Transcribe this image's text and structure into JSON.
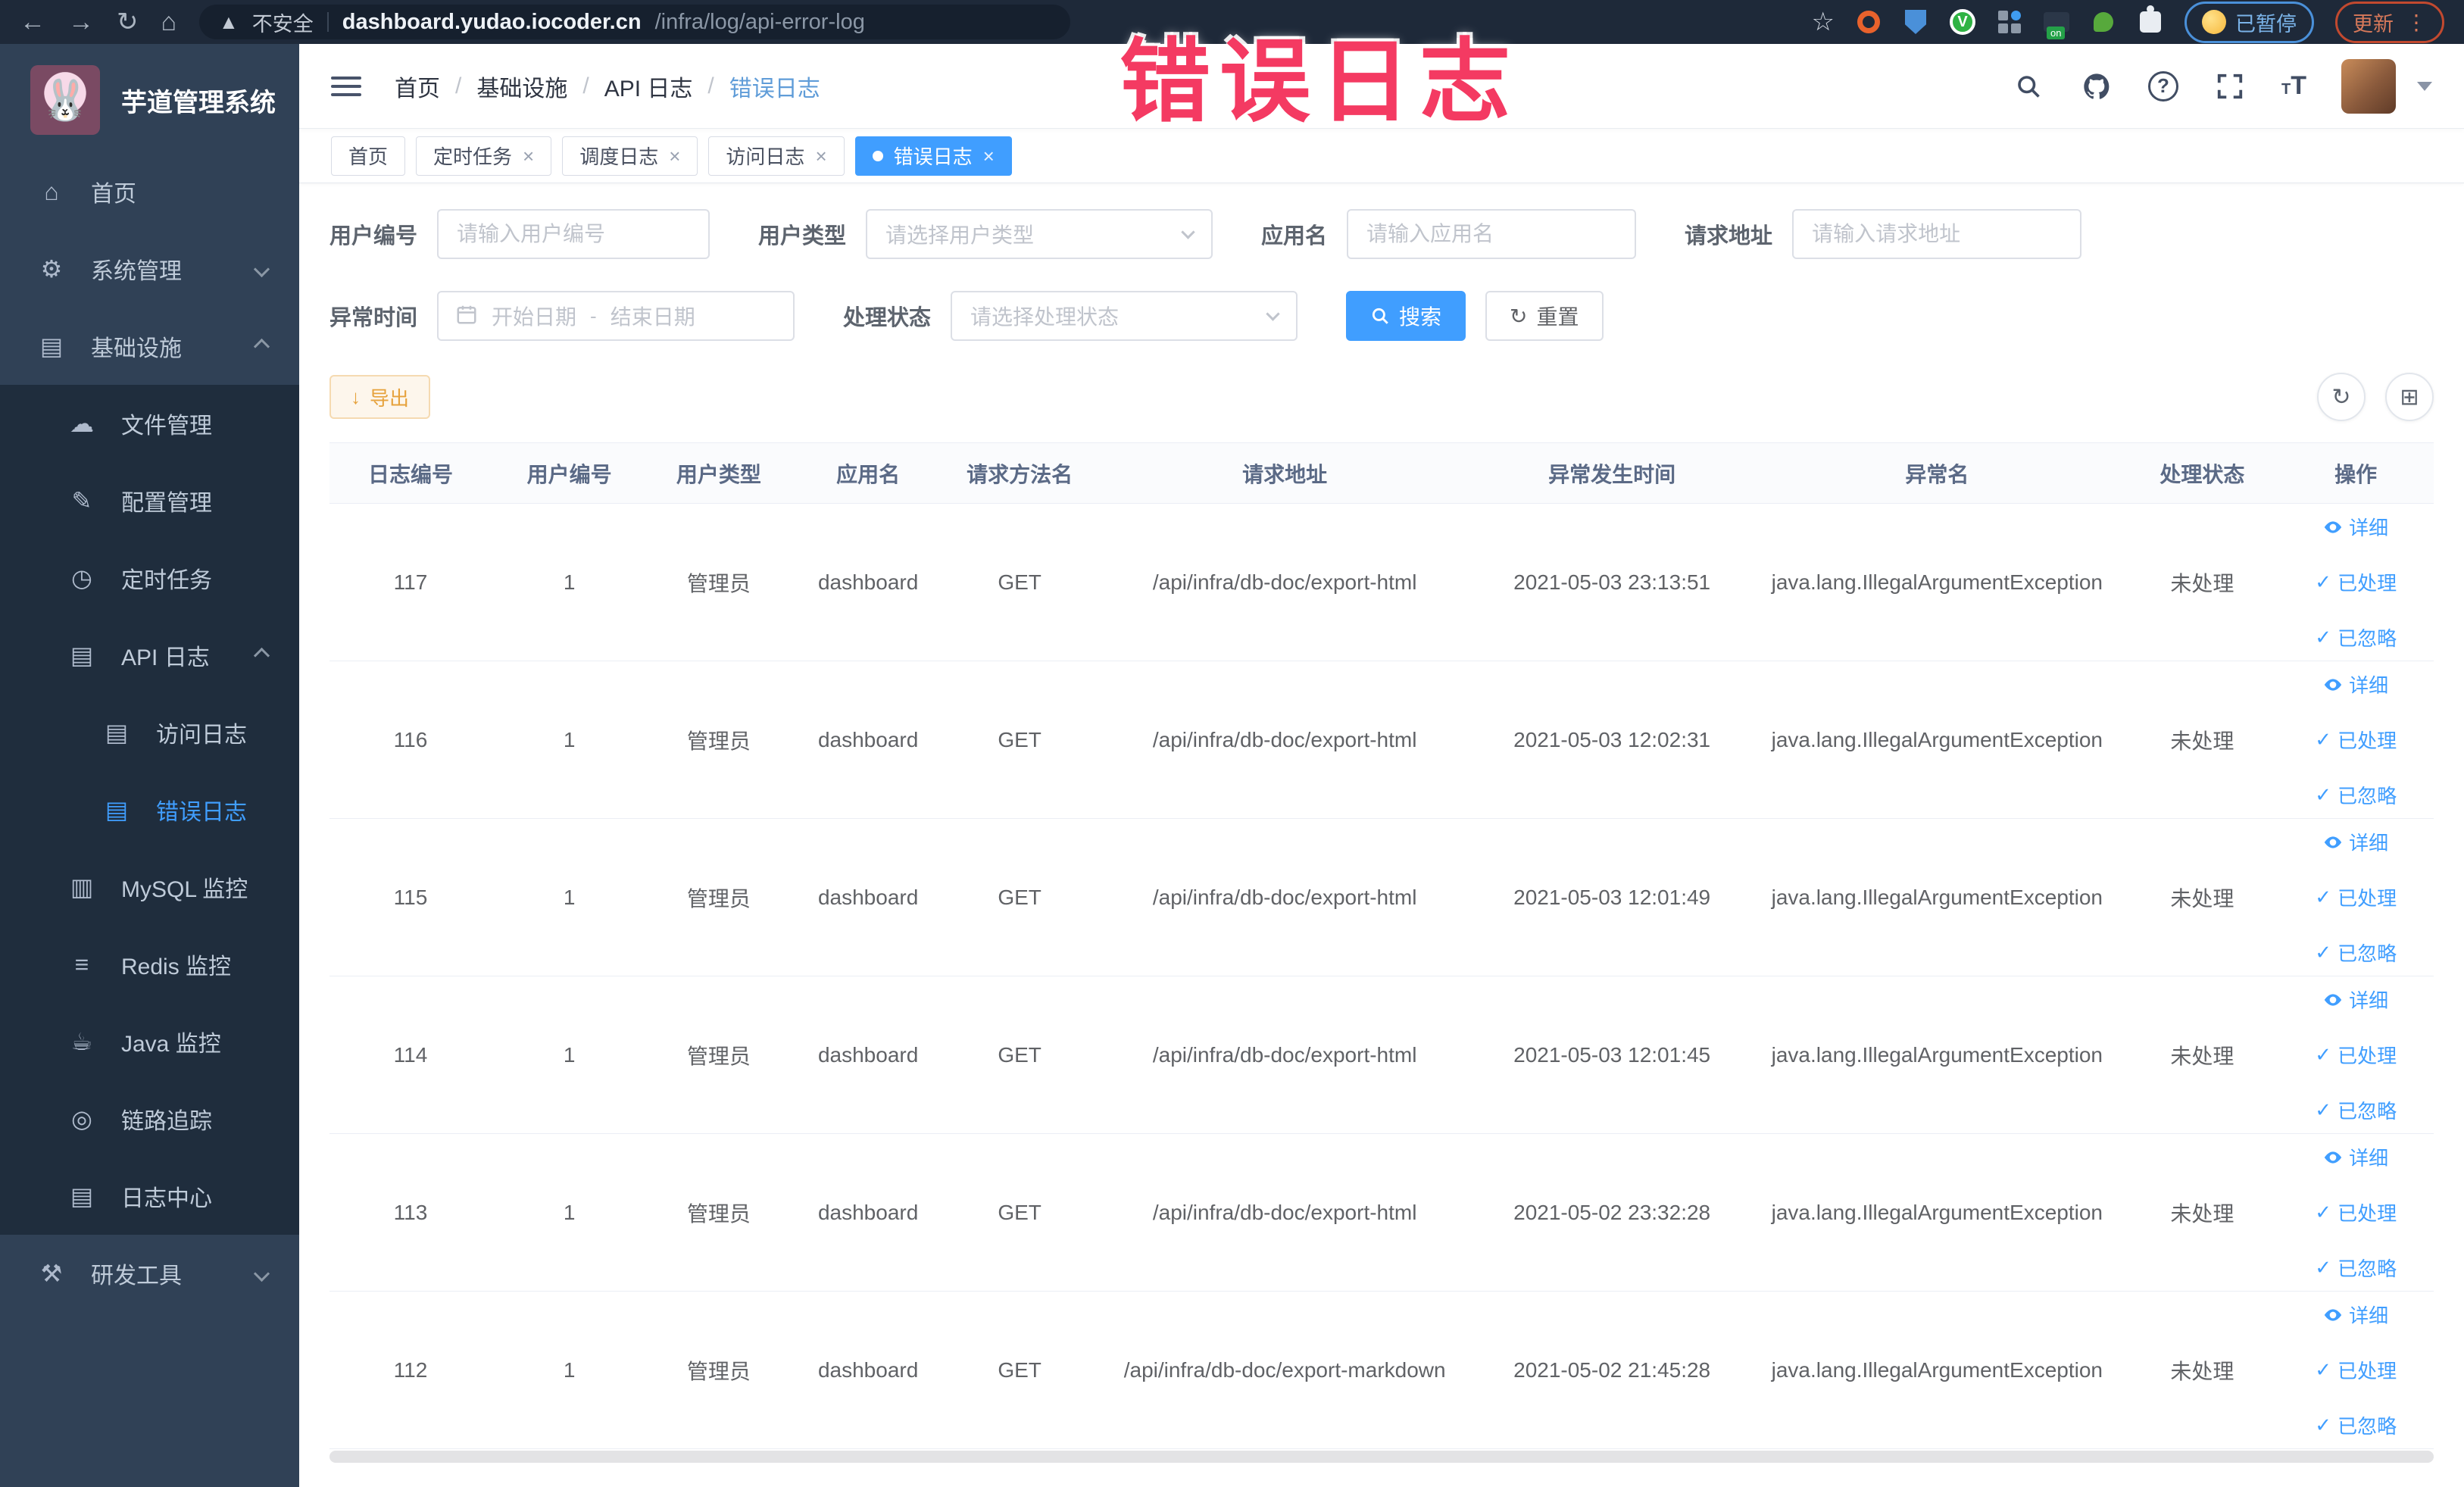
{
  "browser": {
    "security_label": "不安全",
    "url_host": "dashboard.yudao.iocoder.cn",
    "url_path": "/infra/log/api-error-log",
    "paused_label": "已暂停",
    "update_label": "更新"
  },
  "annotation": {
    "text": "错误日志",
    "color": "#f43a62"
  },
  "sidebar": {
    "title": "芋道管理系统",
    "items": [
      {
        "label": "首页"
      },
      {
        "label": "系统管理"
      },
      {
        "label": "基础设施"
      },
      {
        "label": "文件管理"
      },
      {
        "label": "配置管理"
      },
      {
        "label": "定时任务"
      },
      {
        "label": "API 日志"
      },
      {
        "label": "访问日志"
      },
      {
        "label": "错误日志"
      },
      {
        "label": "MySQL 监控"
      },
      {
        "label": "Redis 监控"
      },
      {
        "label": "Java 监控"
      },
      {
        "label": "链路追踪"
      },
      {
        "label": "日志中心"
      },
      {
        "label": "研发工具"
      }
    ]
  },
  "header": {
    "breadcrumb": [
      "首页",
      "基础设施",
      "API 日志",
      "错误日志"
    ]
  },
  "tabs": [
    {
      "label": "首页",
      "closable": false,
      "active": false
    },
    {
      "label": "定时任务",
      "closable": true,
      "active": false
    },
    {
      "label": "调度日志",
      "closable": true,
      "active": false
    },
    {
      "label": "访问日志",
      "closable": true,
      "active": false
    },
    {
      "label": "错误日志",
      "closable": true,
      "active": true
    }
  ],
  "filters": {
    "user_id_label": "用户编号",
    "user_id_placeholder": "请输入用户编号",
    "user_type_label": "用户类型",
    "user_type_placeholder": "请选择用户类型",
    "app_name_label": "应用名",
    "app_name_placeholder": "请输入应用名",
    "request_url_label": "请求地址",
    "request_url_placeholder": "请输入请求地址",
    "exception_time_label": "异常时间",
    "date_start_placeholder": "开始日期",
    "date_separator": "-",
    "date_end_placeholder": "结束日期",
    "process_status_label": "处理状态",
    "process_status_placeholder": "请选择处理状态",
    "search_label": "搜索",
    "reset_label": "重置"
  },
  "toolbar": {
    "export_label": "导出"
  },
  "table": {
    "columns": [
      "日志编号",
      "用户编号",
      "用户类型",
      "应用名",
      "请求方法名",
      "请求地址",
      "异常发生时间",
      "异常名",
      "处理状态",
      "操作"
    ],
    "actions": [
      "详细",
      "已处理",
      "已忽略"
    ],
    "rows": [
      {
        "id": "117",
        "user_id": "1",
        "user_type": "管理员",
        "app": "dashboard",
        "method": "GET",
        "url": "/api/infra/db-doc/export-html",
        "time": "2021-05-03 23:13:51",
        "exception": "java.lang.IllegalArgumentException",
        "status": "未处理"
      },
      {
        "id": "116",
        "user_id": "1",
        "user_type": "管理员",
        "app": "dashboard",
        "method": "GET",
        "url": "/api/infra/db-doc/export-html",
        "time": "2021-05-03 12:02:31",
        "exception": "java.lang.IllegalArgumentException",
        "status": "未处理"
      },
      {
        "id": "115",
        "user_id": "1",
        "user_type": "管理员",
        "app": "dashboard",
        "method": "GET",
        "url": "/api/infra/db-doc/export-html",
        "time": "2021-05-03 12:01:49",
        "exception": "java.lang.IllegalArgumentException",
        "status": "未处理"
      },
      {
        "id": "114",
        "user_id": "1",
        "user_type": "管理员",
        "app": "dashboard",
        "method": "GET",
        "url": "/api/infra/db-doc/export-html",
        "time": "2021-05-03 12:01:45",
        "exception": "java.lang.IllegalArgumentException",
        "status": "未处理"
      },
      {
        "id": "113",
        "user_id": "1",
        "user_type": "管理员",
        "app": "dashboard",
        "method": "GET",
        "url": "/api/infra/db-doc/export-html",
        "time": "2021-05-02 23:32:28",
        "exception": "java.lang.IllegalArgumentException",
        "status": "未处理"
      },
      {
        "id": "112",
        "user_id": "1",
        "user_type": "管理员",
        "app": "dashboard",
        "method": "GET",
        "url": "/api/infra/db-doc/export-markdown",
        "time": "2021-05-02 21:45:28",
        "exception": "java.lang.IllegalArgumentException",
        "status": "未处理"
      }
    ]
  }
}
